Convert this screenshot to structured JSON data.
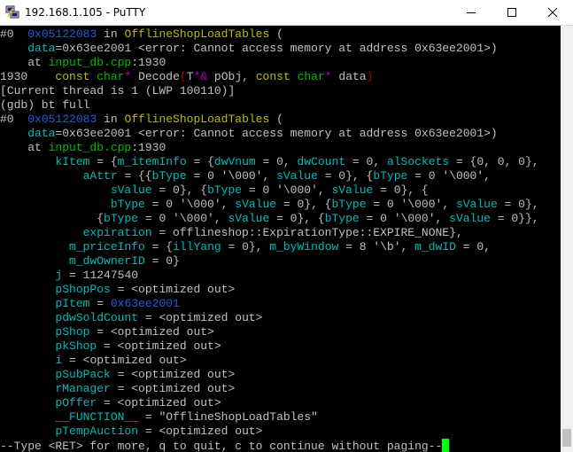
{
  "window": {
    "title": "192.168.1.105 - PuTTY"
  },
  "terminal": {
    "lines": [
      [
        [
          "#0  ",
          "w"
        ],
        [
          "0x05122083",
          "b"
        ],
        [
          " in ",
          "w"
        ],
        [
          "OfflineShopLoadTables",
          "y"
        ],
        [
          " (",
          "w"
        ]
      ],
      [
        [
          "    ",
          "w"
        ],
        [
          "data",
          "c"
        ],
        [
          "=0x63ee2001 <error: Cannot access memory at address 0x63ee2001>)",
          "w"
        ]
      ],
      [
        [
          "    at ",
          "w"
        ],
        [
          "input_db.cpp",
          "g"
        ],
        [
          ":1930",
          "w"
        ]
      ],
      [
        [
          "1930    ",
          "w"
        ],
        [
          "const",
          "y"
        ],
        [
          " ",
          "w"
        ],
        [
          "char",
          "g"
        ],
        [
          "*",
          "m"
        ],
        [
          " Decode",
          "w"
        ],
        [
          "(",
          "r"
        ],
        [
          "T",
          "w"
        ],
        [
          "*&",
          "m"
        ],
        [
          " pObj, ",
          "w"
        ],
        [
          "const",
          "y"
        ],
        [
          " ",
          "w"
        ],
        [
          "char",
          "g"
        ],
        [
          "*",
          "m"
        ],
        [
          " data",
          "w"
        ],
        [
          ")",
          "r"
        ]
      ],
      [
        [
          "[Current thread is 1 (LWP 100110)]",
          "w"
        ]
      ],
      [
        [
          "(gdb) bt full",
          "w"
        ]
      ],
      [
        [
          "#0  ",
          "w"
        ],
        [
          "0x05122083",
          "b"
        ],
        [
          " in ",
          "w"
        ],
        [
          "OfflineShopLoadTables",
          "y"
        ],
        [
          " (",
          "w"
        ]
      ],
      [
        [
          "    ",
          "w"
        ],
        [
          "data",
          "c"
        ],
        [
          "=0x63ee2001 <error: Cannot access memory at address 0x63ee2001>)",
          "w"
        ]
      ],
      [
        [
          "    at ",
          "w"
        ],
        [
          "input_db.cpp",
          "g"
        ],
        [
          ":1930",
          "w"
        ]
      ],
      [
        [
          "        ",
          "w"
        ],
        [
          "kItem",
          "c"
        ],
        [
          " = {",
          "w"
        ],
        [
          "m_itemInfo",
          "c"
        ],
        [
          " = {",
          "w"
        ],
        [
          "dwVnum",
          "c"
        ],
        [
          " = 0, ",
          "w"
        ],
        [
          "dwCount",
          "c"
        ],
        [
          " = 0, ",
          "w"
        ],
        [
          "alSockets",
          "c"
        ],
        [
          " = {0, 0, 0},",
          "w"
        ]
      ],
      [
        [
          "            ",
          "w"
        ],
        [
          "aAttr",
          "c"
        ],
        [
          " = {{",
          "w"
        ],
        [
          "bType",
          "c"
        ],
        [
          " = 0 '\\000', ",
          "w"
        ],
        [
          "sValue",
          "c"
        ],
        [
          " = 0}, {",
          "w"
        ],
        [
          "bType",
          "c"
        ],
        [
          " = 0 '\\000',",
          "w"
        ]
      ],
      [
        [
          "                ",
          "w"
        ],
        [
          "sValue",
          "c"
        ],
        [
          " = 0}, {",
          "w"
        ],
        [
          "bType",
          "c"
        ],
        [
          " = 0 '\\000', ",
          "w"
        ],
        [
          "sValue",
          "c"
        ],
        [
          " = 0}, {",
          "w"
        ]
      ],
      [
        [
          "                ",
          "w"
        ],
        [
          "bType",
          "c"
        ],
        [
          " = 0 '\\000', ",
          "w"
        ],
        [
          "sValue",
          "c"
        ],
        [
          " = 0}, {",
          "w"
        ],
        [
          "bType",
          "c"
        ],
        [
          " = 0 '\\000', ",
          "w"
        ],
        [
          "sValue",
          "c"
        ],
        [
          " = 0},",
          "w"
        ]
      ],
      [
        [
          "              {",
          "w"
        ],
        [
          "bType",
          "c"
        ],
        [
          " = 0 '\\000', ",
          "w"
        ],
        [
          "sValue",
          "c"
        ],
        [
          " = 0}, {",
          "w"
        ],
        [
          "bType",
          "c"
        ],
        [
          " = 0 '\\000', ",
          "w"
        ],
        [
          "sValue",
          "c"
        ],
        [
          " = 0}},",
          "w"
        ]
      ],
      [
        [
          "            ",
          "w"
        ],
        [
          "expiration",
          "c"
        ],
        [
          " = offlineshop::ExpirationType::EXPIRE_NONE},",
          "w"
        ]
      ],
      [
        [
          "          ",
          "w"
        ],
        [
          "m_priceInfo",
          "c"
        ],
        [
          " = {",
          "w"
        ],
        [
          "illYang",
          "c"
        ],
        [
          " = 0}, ",
          "w"
        ],
        [
          "m_byWindow",
          "c"
        ],
        [
          " = 8 '\\b', ",
          "w"
        ],
        [
          "m_dwID",
          "c"
        ],
        [
          " = 0,",
          "w"
        ]
      ],
      [
        [
          "          ",
          "w"
        ],
        [
          "m_dwOwnerID",
          "c"
        ],
        [
          " = 0}",
          "w"
        ]
      ],
      [
        [
          "        ",
          "w"
        ],
        [
          "j",
          "c"
        ],
        [
          " = 11247540",
          "w"
        ]
      ],
      [
        [
          "        ",
          "w"
        ],
        [
          "pShopPos",
          "c"
        ],
        [
          " = <optimized out>",
          "w"
        ]
      ],
      [
        [
          "        ",
          "w"
        ],
        [
          "pItem",
          "c"
        ],
        [
          " = ",
          "w"
        ],
        [
          "0x63ee2001",
          "b"
        ]
      ],
      [
        [
          "        ",
          "w"
        ],
        [
          "pdwSoldCount",
          "c"
        ],
        [
          " = <optimized out>",
          "w"
        ]
      ],
      [
        [
          "        ",
          "w"
        ],
        [
          "pShop",
          "c"
        ],
        [
          " = <optimized out>",
          "w"
        ]
      ],
      [
        [
          "        ",
          "w"
        ],
        [
          "pkShop",
          "c"
        ],
        [
          " = <optimized out>",
          "w"
        ]
      ],
      [
        [
          "        ",
          "w"
        ],
        [
          "i",
          "c"
        ],
        [
          " = <optimized out>",
          "w"
        ]
      ],
      [
        [
          "        ",
          "w"
        ],
        [
          "pSubPack",
          "c"
        ],
        [
          " = <optimized out>",
          "w"
        ]
      ],
      [
        [
          "        ",
          "w"
        ],
        [
          "rManager",
          "c"
        ],
        [
          " = <optimized out>",
          "w"
        ]
      ],
      [
        [
          "        ",
          "w"
        ],
        [
          "pOffer",
          "c"
        ],
        [
          " = <optimized out>",
          "w"
        ]
      ],
      [
        [
          "        ",
          "w"
        ],
        [
          "__FUNCTION__",
          "c"
        ],
        [
          " = \"OfflineShopLoadTables\"",
          "w"
        ]
      ],
      [
        [
          "        ",
          "w"
        ],
        [
          "pTempAuction",
          "c"
        ],
        [
          " = <optimized out>",
          "w"
        ]
      ],
      [
        [
          "--Type <RET> for more, q to quit, c to continue without paging--",
          "w"
        ]
      ]
    ]
  },
  "colors": {
    "background": "#000000",
    "default_text": "#c0c0c0",
    "cursor": "#00ff00",
    "function_name": "#bbbb00",
    "variable": "#00bbbb",
    "address": "#2a5ad8",
    "file": "#00bb00"
  },
  "icons": {
    "app": "putty-icon",
    "minimize": "minimize-icon",
    "maximize": "maximize-icon",
    "close": "close-icon"
  }
}
